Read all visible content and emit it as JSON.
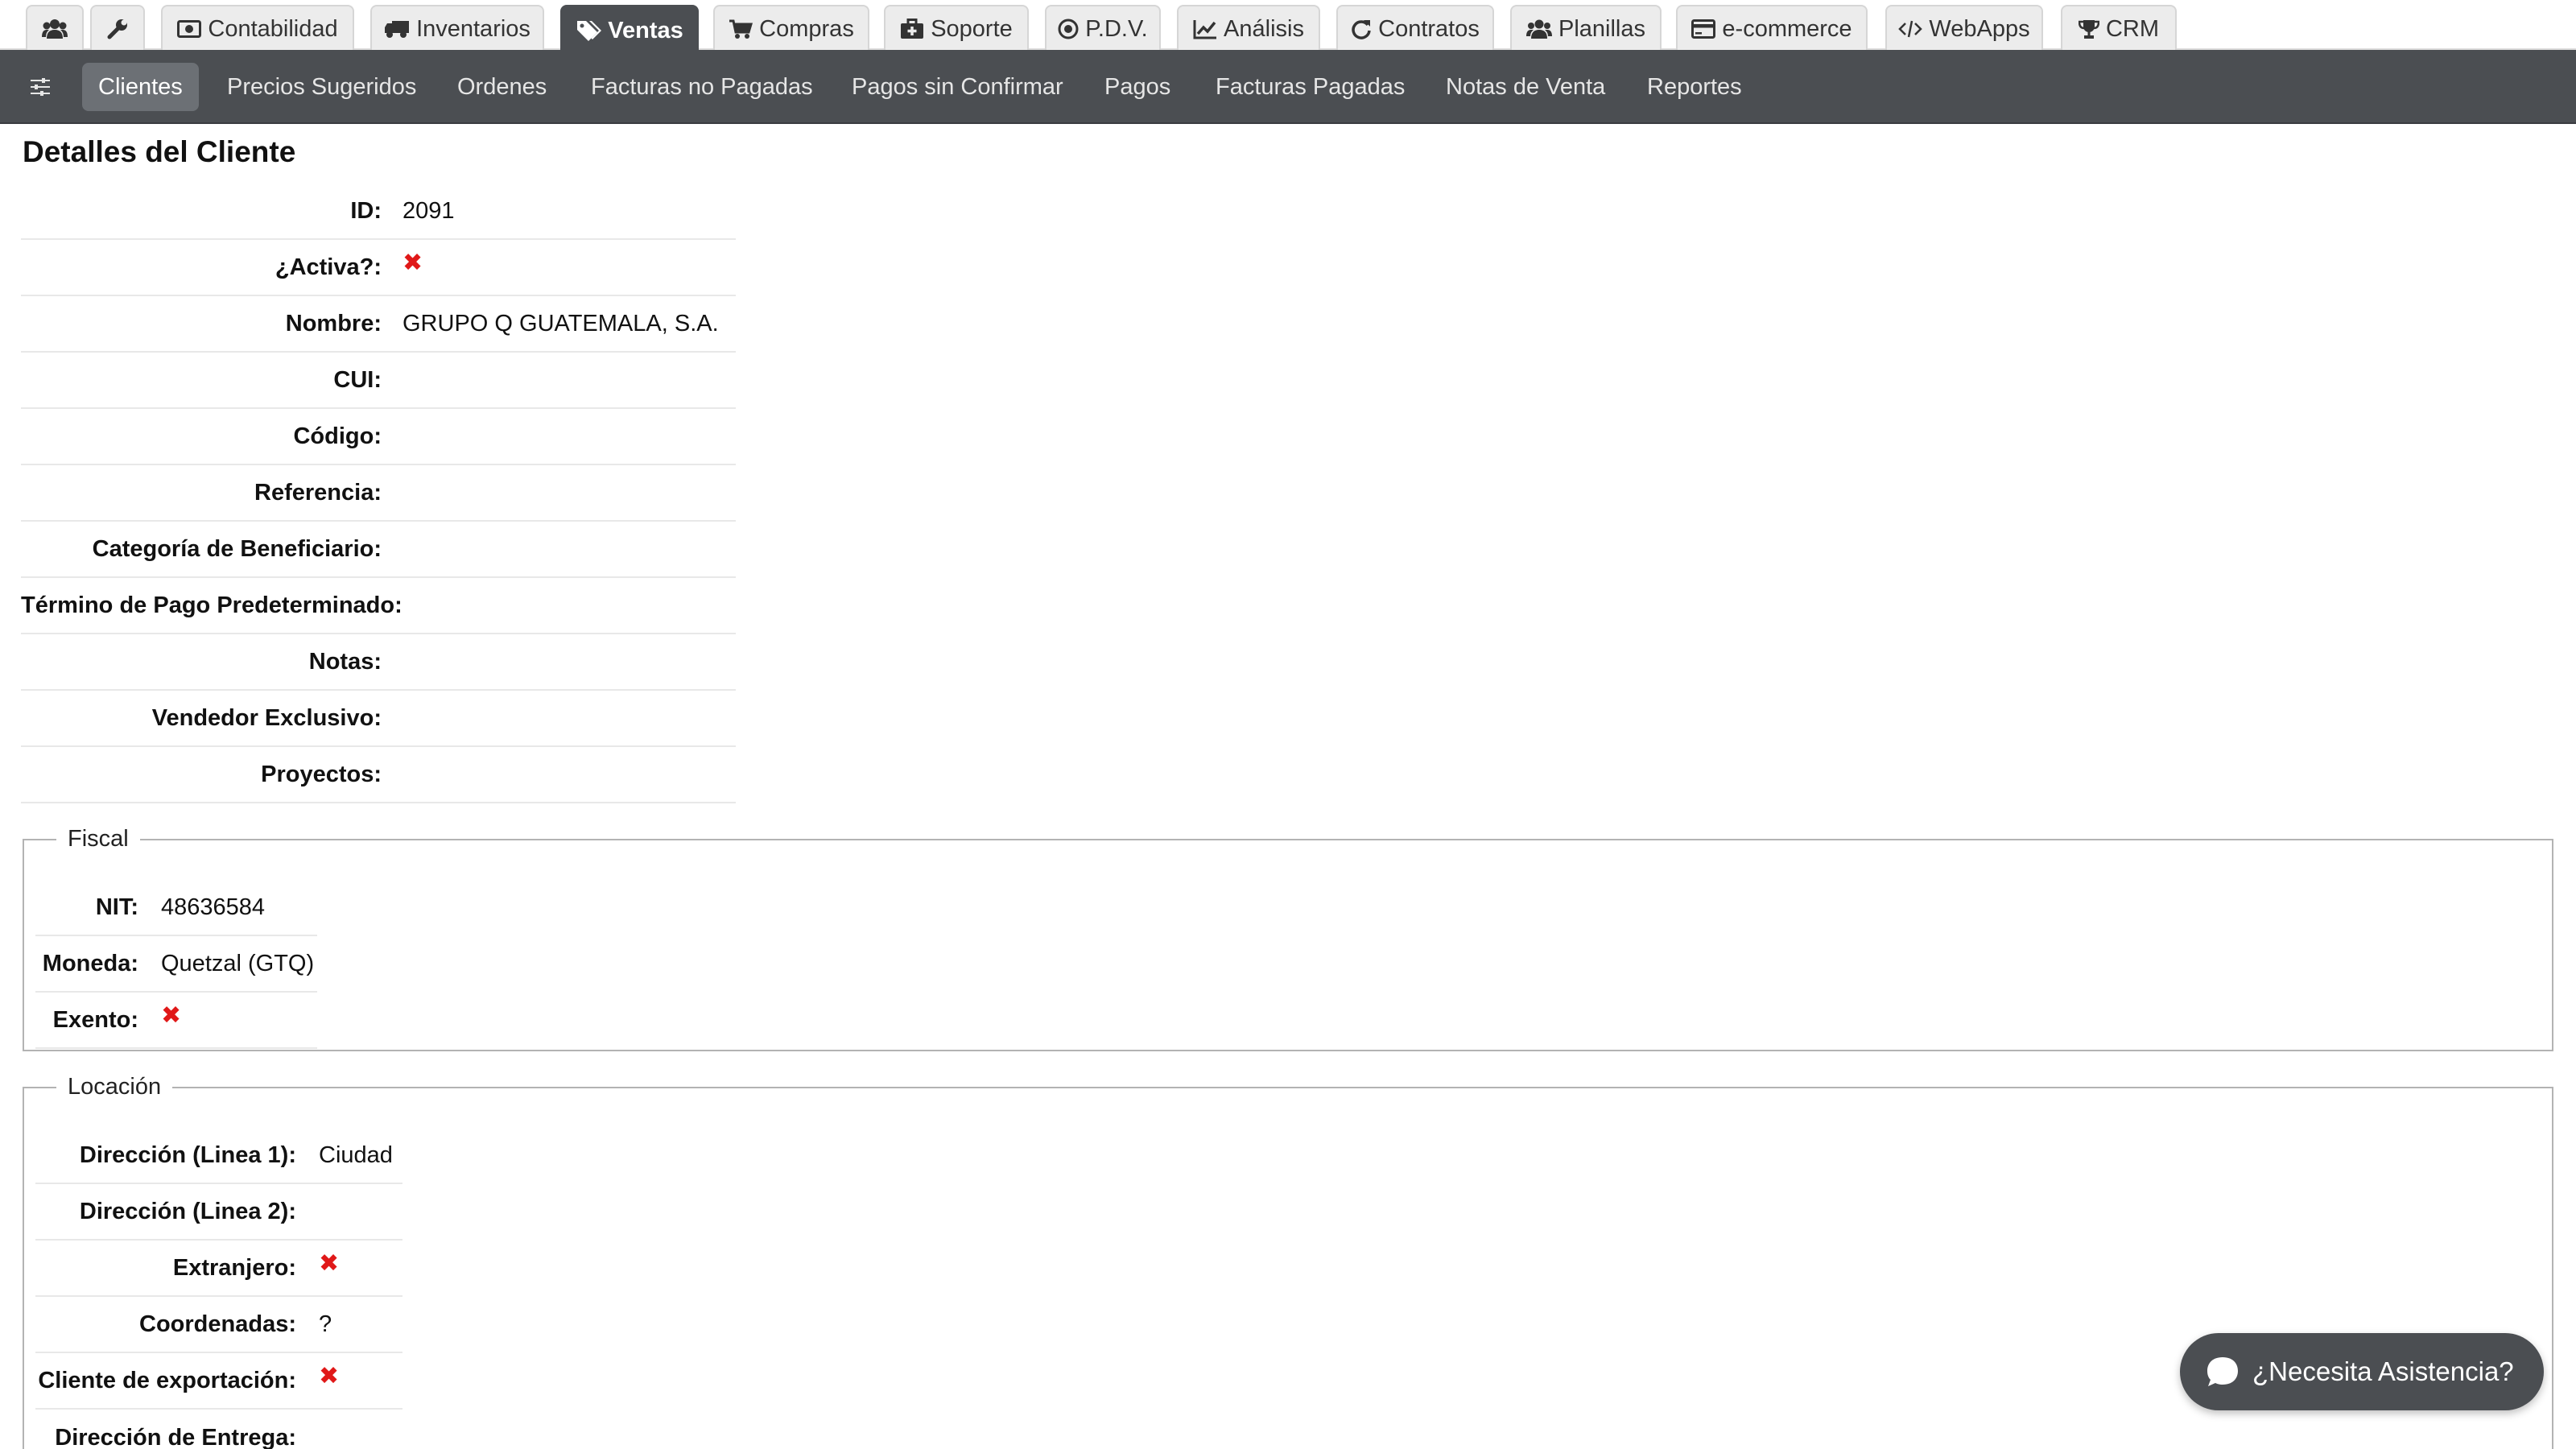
{
  "colors": {
    "chrome_dark": "#4b4e52",
    "tab_inactive": "#ececec",
    "cross_red": "#e01818"
  },
  "top_tabs": [
    {
      "label": "",
      "icon": "users-icon"
    },
    {
      "label": "",
      "icon": "wrench-icon"
    },
    {
      "label": "Contabilidad",
      "icon": "money-icon"
    },
    {
      "label": "Inventarios",
      "icon": "truck-icon"
    },
    {
      "label": "Ventas",
      "icon": "tags-icon",
      "active": true
    },
    {
      "label": "Compras",
      "icon": "cart-icon"
    },
    {
      "label": "Soporte",
      "icon": "medkit-icon"
    },
    {
      "label": "P.D.V.",
      "icon": "target-icon"
    },
    {
      "label": "Análisis",
      "icon": "line-chart-icon"
    },
    {
      "label": "Contratos",
      "icon": "refresh-icon"
    },
    {
      "label": "Planillas",
      "icon": "group-icon"
    },
    {
      "label": "e-commerce",
      "icon": "credit-card-icon"
    },
    {
      "label": "WebApps",
      "icon": "code-icon"
    },
    {
      "label": "CRM",
      "icon": "trophy-icon"
    }
  ],
  "subnav": {
    "toggle_icon": "sliders-icon",
    "items": [
      {
        "label": "Clientes",
        "active": true
      },
      {
        "label": "Precios Sugeridos"
      },
      {
        "label": "Ordenes"
      },
      {
        "label": "Facturas no Pagadas"
      },
      {
        "label": "Pagos sin Confirmar"
      },
      {
        "label": "Pagos"
      },
      {
        "label": "Facturas Pagadas"
      },
      {
        "label": "Notas de Venta"
      },
      {
        "label": "Reportes"
      }
    ]
  },
  "page_title": "Detalles del Cliente",
  "details": [
    {
      "label": "ID:",
      "value": "2091"
    },
    {
      "label": "¿Activa?:",
      "value": "",
      "cross": true
    },
    {
      "label": "Nombre:",
      "value": "GRUPO Q GUATEMALA, S.A."
    },
    {
      "label": "CUI:",
      "value": ""
    },
    {
      "label": "Código:",
      "value": ""
    },
    {
      "label": "Referencia:",
      "value": ""
    },
    {
      "label": "Categoría de Beneficiario:",
      "value": ""
    },
    {
      "label": "Término de Pago Predeterminado:",
      "value": ""
    },
    {
      "label": "Notas:",
      "value": ""
    },
    {
      "label": "Vendedor Exclusivo:",
      "value": ""
    },
    {
      "label": "Proyectos:",
      "value": ""
    }
  ],
  "fiscal": {
    "legend": "Fiscal",
    "rows": [
      {
        "label": "NIT:",
        "value": "48636584"
      },
      {
        "label": "Moneda:",
        "value": "Quetzal (GTQ)"
      },
      {
        "label": "Exento:",
        "value": "",
        "cross": true
      }
    ]
  },
  "location": {
    "legend": "Locación",
    "rows": [
      {
        "label": "Dirección (Linea 1):",
        "value": "Ciudad"
      },
      {
        "label": "Dirección (Linea 2):",
        "value": ""
      },
      {
        "label": "Extranjero:",
        "value": "",
        "cross": true
      },
      {
        "label": "Coordenadas:",
        "value": "?"
      },
      {
        "label": "Cliente de exportación:",
        "value": "",
        "cross": true
      },
      {
        "label": "Dirección de Entrega:",
        "value": ""
      }
    ]
  },
  "help_button": {
    "label": "¿Necesita Asistencia?",
    "icon": "chat-bubble-icon"
  },
  "cross_symbol": "✖"
}
